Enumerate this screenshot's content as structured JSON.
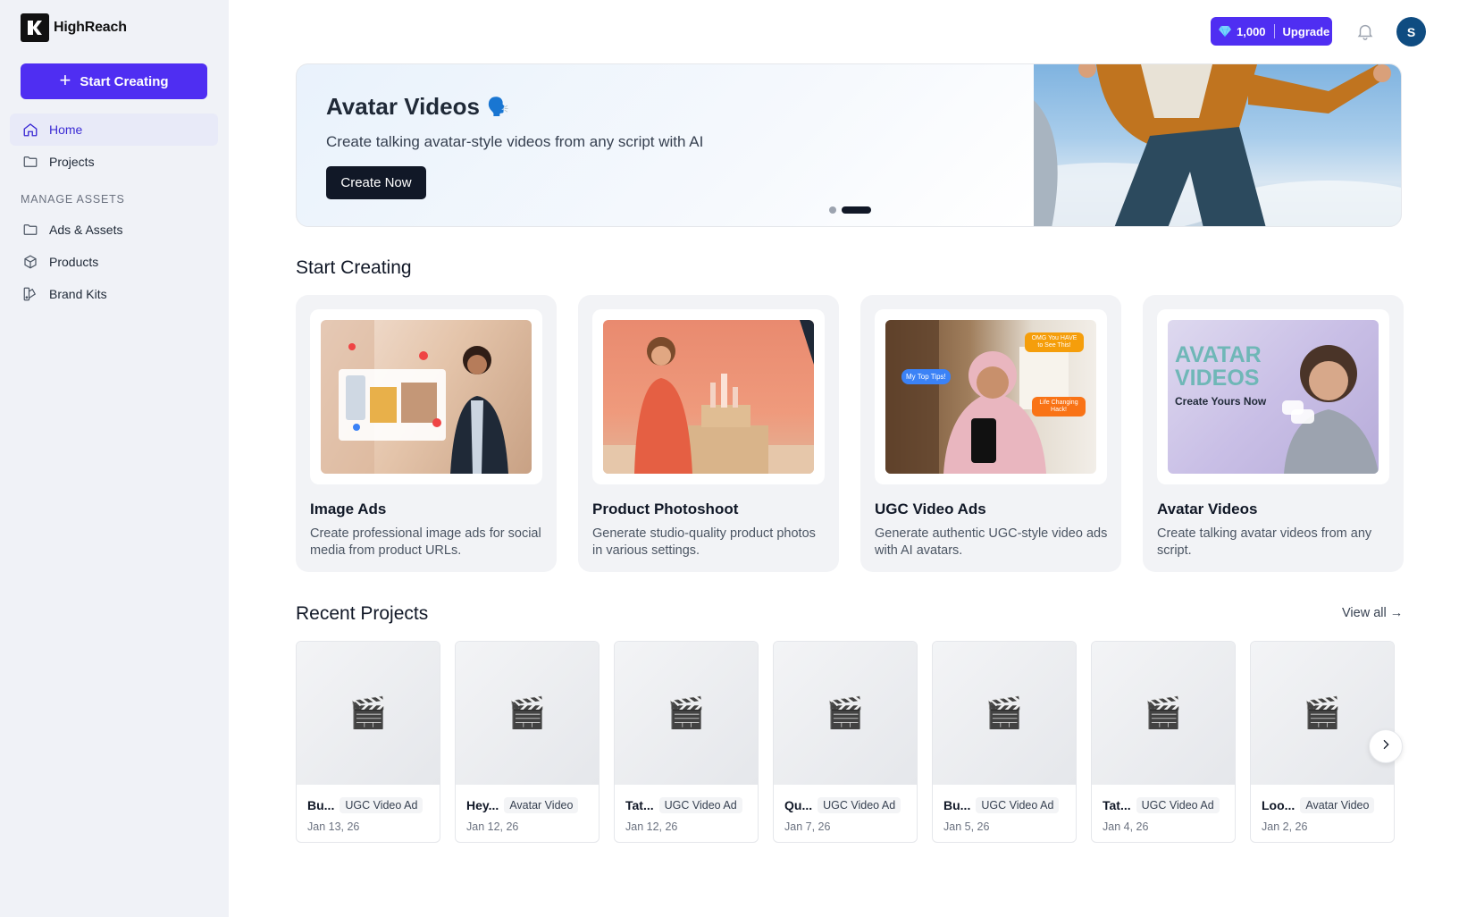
{
  "brand": {
    "name": "HighReach"
  },
  "sidebar": {
    "start_button": "Start Creating",
    "items": [
      {
        "label": "Home",
        "icon": "home-icon",
        "active": true
      },
      {
        "label": "Projects",
        "icon": "folder-icon",
        "active": false
      }
    ],
    "section_label": "MANAGE ASSETS",
    "asset_items": [
      {
        "label": "Ads & Assets",
        "icon": "folder-icon"
      },
      {
        "label": "Products",
        "icon": "box-icon"
      },
      {
        "label": "Brand Kits",
        "icon": "palette-icon"
      }
    ]
  },
  "topbar": {
    "credits": "1,000",
    "upgrade": "Upgrade",
    "avatar_initial": "S",
    "accent": "#4f2ef2"
  },
  "hero": {
    "title": "Avatar Videos",
    "emoji": "🗣️",
    "subtitle": "Create talking avatar-style videos from any script with AI",
    "cta": "Create Now"
  },
  "start_creating": {
    "heading": "Start Creating",
    "cards": [
      {
        "title": "Image Ads",
        "desc": "Create professional image ads for social media from product URLs."
      },
      {
        "title": "Product Photoshoot",
        "desc": "Generate studio-quality product photos in various settings."
      },
      {
        "title": "UGC Video Ads",
        "desc": "Generate authentic UGC-style video ads with AI avatars.",
        "bubbles": [
          "My Top Tips!",
          "OMG You HAVE to See This!",
          "Life Changing Hack!"
        ]
      },
      {
        "title": "Avatar Videos",
        "desc": "Create talking avatar videos from any script.",
        "overlay_title": "AVATAR VIDEOS",
        "overlay_sub": "Create Yours Now"
      }
    ]
  },
  "recent": {
    "heading": "Recent Projects",
    "view_all": "View all →",
    "projects": [
      {
        "name": "Bu...",
        "type": "UGC Video Ad",
        "date": "Jan 13, 26"
      },
      {
        "name": "Hey...",
        "type": "Avatar Video",
        "date": "Jan 12, 26"
      },
      {
        "name": "Tat...",
        "type": "UGC Video Ad",
        "date": "Jan 12, 26"
      },
      {
        "name": "Qu...",
        "type": "UGC Video Ad",
        "date": "Jan 7, 26"
      },
      {
        "name": "Bu...",
        "type": "UGC Video Ad",
        "date": "Jan 5, 26"
      },
      {
        "name": "Tat...",
        "type": "UGC Video Ad",
        "date": "Jan 4, 26"
      },
      {
        "name": "Loo...",
        "type": "Avatar Video",
        "date": "Jan 2, 26"
      }
    ],
    "thumb_icon": "🎬"
  }
}
